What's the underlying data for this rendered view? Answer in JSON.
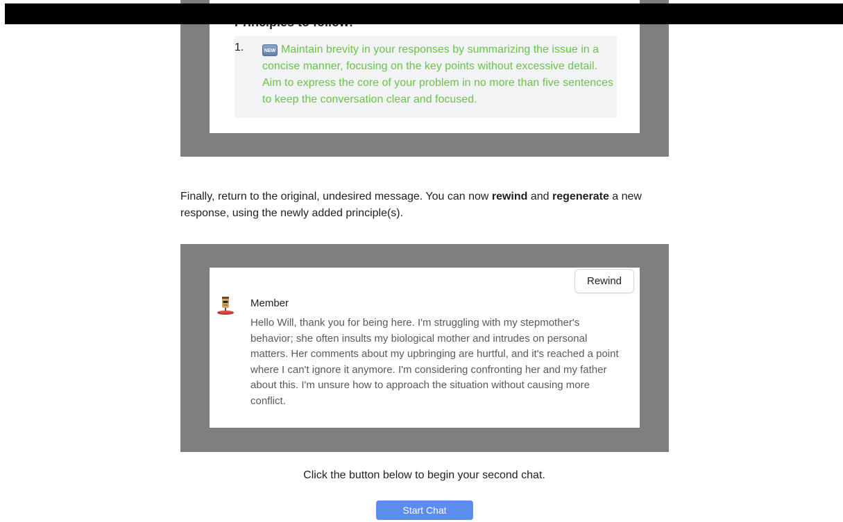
{
  "principles_panel": {
    "heading": "Principles to follow:",
    "items": [
      {
        "number": "1.",
        "badge": "NEW",
        "text": "Maintain brevity in your responses by summarizing the issue in a concise manner, focusing on the key points without excessive detail. Aim to express the core of your problem in no more than five sentences to keep the conversation clear and focused."
      }
    ],
    "text_color": "#6cc24a"
  },
  "instruction": {
    "part1": "Finally, return to the original, undesired message. You can now ",
    "bold1": "rewind",
    "part2": " and ",
    "bold2": "regenerate",
    "part3": " a new response, using the newly added principle(s)."
  },
  "chat_panel": {
    "rewind_label": "Rewind",
    "avatar_icon": "robot-avatar-icon",
    "sender": "Member",
    "message": "Hello Will, thank you for being here. I'm struggling with my stepmother's behavior; she often insults my biological mother and intrudes on personal matters. Her comments about my upbringing are hurtful, and it's reached a point where I can't ignore it anymore. I'm considering confronting her and my father about this. I'm unsure how to approach the situation without causing more conflict."
  },
  "cta": {
    "text": "Click the button below to begin your second chat.",
    "button_label": "Start Chat",
    "button_color": "#5b8def"
  }
}
